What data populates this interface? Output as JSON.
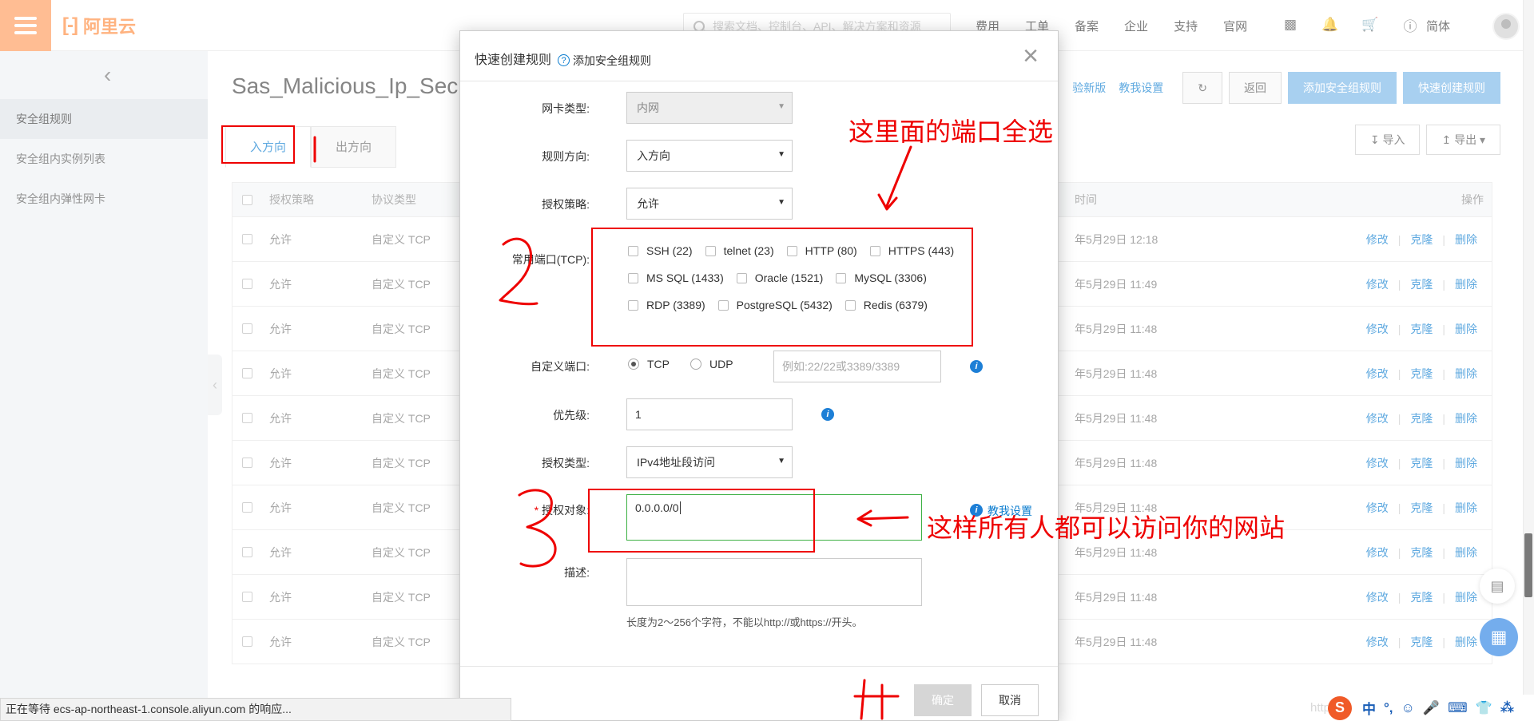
{
  "topbar": {
    "logo_text": "阿里云",
    "search_placeholder": "搜索文档、控制台、API、解决方案和资源",
    "nav": [
      "费用",
      "工单",
      "备案",
      "企业",
      "支持",
      "官网"
    ],
    "icons": [
      "terminal-icon",
      "bell-icon",
      "cart-icon",
      "help-icon"
    ],
    "lang": "简体"
  },
  "sidebar": {
    "items": [
      "安全组规则",
      "安全组内实例列表",
      "安全组内弹性网卡"
    ]
  },
  "main": {
    "title": "Sas_Malicious_Ip_Sec",
    "tabs": [
      "入方向",
      "出方向"
    ],
    "links": [
      "验新版",
      "教我设置"
    ],
    "buttons": {
      "back": "返回",
      "add_rule": "添加安全组规则",
      "quick_create": "快速创建规则",
      "import": "导入",
      "export": "导出"
    },
    "table": {
      "headers": {
        "policy": "授权策略",
        "protocol": "协议类型",
        "time": "时间",
        "ops": "操作"
      },
      "rows": [
        {
          "policy": "允许",
          "protocol": "自定义 TCP",
          "time": "年5月29日 12:18"
        },
        {
          "policy": "允许",
          "protocol": "自定义 TCP",
          "time": "年5月29日 11:49"
        },
        {
          "policy": "允许",
          "protocol": "自定义 TCP",
          "time": "年5月29日 11:48"
        },
        {
          "policy": "允许",
          "protocol": "自定义 TCP",
          "time": "年5月29日 11:48"
        },
        {
          "policy": "允许",
          "protocol": "自定义 TCP",
          "time": "年5月29日 11:48"
        },
        {
          "policy": "允许",
          "protocol": "自定义 TCP",
          "time": "年5月29日 11:48"
        },
        {
          "policy": "允许",
          "protocol": "自定义 TCP",
          "time": "年5月29日 11:48"
        },
        {
          "policy": "允许",
          "protocol": "自定义 TCP",
          "time": "年5月29日 11:48"
        },
        {
          "policy": "允许",
          "protocol": "自定义 TCP",
          "time": "年5月29日 11:48"
        },
        {
          "policy": "允许",
          "protocol": "自定义 TCP",
          "time": "年5月29日 11:48"
        }
      ],
      "ops": [
        "修改",
        "克隆",
        "删除"
      ],
      "delete_btn": "删除"
    }
  },
  "modal": {
    "title": "快速创建规则",
    "help_link": "添加安全组规则",
    "fields": {
      "nic_type": {
        "label": "网卡类型:",
        "value": "内网"
      },
      "direction": {
        "label": "规则方向:",
        "value": "入方向"
      },
      "policy": {
        "label": "授权策略:",
        "value": "允许"
      },
      "common_ports": {
        "label": "常用端口(TCP):",
        "rows": [
          [
            "SSH (22)",
            "telnet (23)",
            "HTTP (80)",
            "HTTPS (443)"
          ],
          [
            "MS SQL (1433)",
            "Oracle (1521)",
            "MySQL (3306)"
          ],
          [
            "RDP (3389)",
            "PostgreSQL (5432)",
            "Redis (6379)"
          ]
        ]
      },
      "custom_port": {
        "label": "自定义端口:",
        "tcp": "TCP",
        "udp": "UDP",
        "placeholder": "例如:22/22或3389/3389"
      },
      "priority": {
        "label": "优先级:",
        "value": "1"
      },
      "auth_type": {
        "label": "授权类型:",
        "value": "IPv4地址段访问"
      },
      "auth_object": {
        "label": "授权对象:",
        "value": "0.0.0.0/0",
        "link": "教我设置"
      },
      "description": {
        "label": "描述:",
        "hint": "长度为2～256个字符，不能以http://或https://开头。"
      }
    },
    "ok": "确定",
    "cancel": "取消"
  },
  "statusbar": {
    "text": "正在等待 ecs-ap-northeast-1.console.aliyun.com 的响应..."
  },
  "watermark": "https://",
  "ime": {
    "items": [
      "中",
      "°,",
      "☺",
      "🎤",
      "⌨",
      "👕",
      "⁂"
    ]
  },
  "annotations": {
    "ports_note": "这里面的端口全选",
    "access_note": "这样所有人都可以访问你的网站"
  }
}
